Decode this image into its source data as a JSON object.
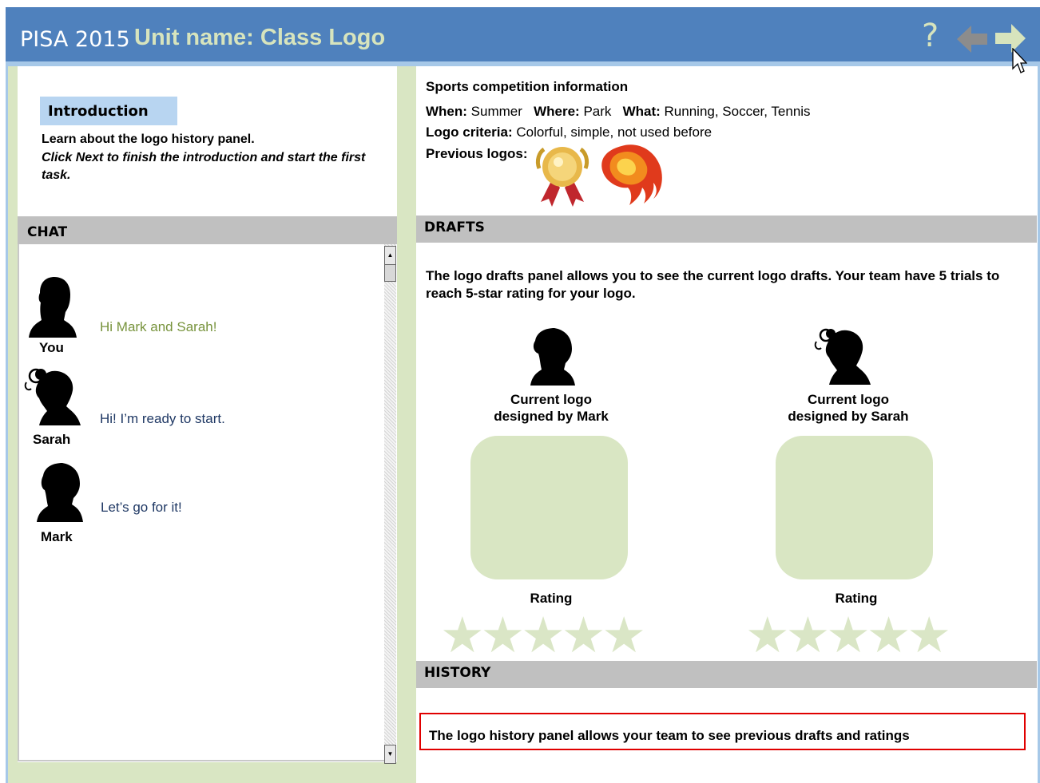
{
  "header": {
    "program": "PISA 2015",
    "unit_title": "Unit name: Class Logo",
    "help_label": "?"
  },
  "intro": {
    "tab_label": "Introduction",
    "line1": "Learn about the logo history panel.",
    "line2": "Click Next to finish the introduction and start the first task."
  },
  "chat": {
    "header": "CHAT",
    "messages": [
      {
        "name": "You",
        "text": "Hi Mark and Sarah!",
        "color": "#77933c"
      },
      {
        "name": "Sarah",
        "text": "Hi! I’m ready to start.",
        "color": "#1f3864"
      },
      {
        "name": "Mark",
        "text": "Let’s go for it!",
        "color": "#1f3864"
      }
    ]
  },
  "sports": {
    "title": "Sports competition information",
    "when_label": "When:",
    "when_value": "Summer",
    "where_label": "Where:",
    "where_value": "Park",
    "what_label": "What:",
    "what_value": "Running, Soccer, Tennis",
    "criteria_label": "Logo criteria:",
    "criteria_value": "Colorful, simple, not used before",
    "previous_label": "Previous logos:"
  },
  "drafts": {
    "header": "DRAFTS",
    "description": "The logo drafts panel allows you to see the current logo drafts. Your team have 5 trials to reach 5-star rating for your logo.",
    "designers": [
      {
        "line1": "Current logo",
        "line2": "designed by Mark",
        "rating_label": "Rating",
        "stars": 5,
        "stars_filled": 0
      },
      {
        "line1": "Current logo",
        "line2": "designed by Sarah",
        "rating_label": "Rating",
        "stars": 5,
        "stars_filled": 0
      }
    ]
  },
  "history": {
    "header": "HISTORY",
    "description": "The logo history panel allows your team to see previous drafts and ratings"
  },
  "colors": {
    "header_blue": "#4f81bd",
    "title_green": "#d7e4bd",
    "panel_green": "#d9e6c3",
    "highlight_red": "#e00000"
  }
}
